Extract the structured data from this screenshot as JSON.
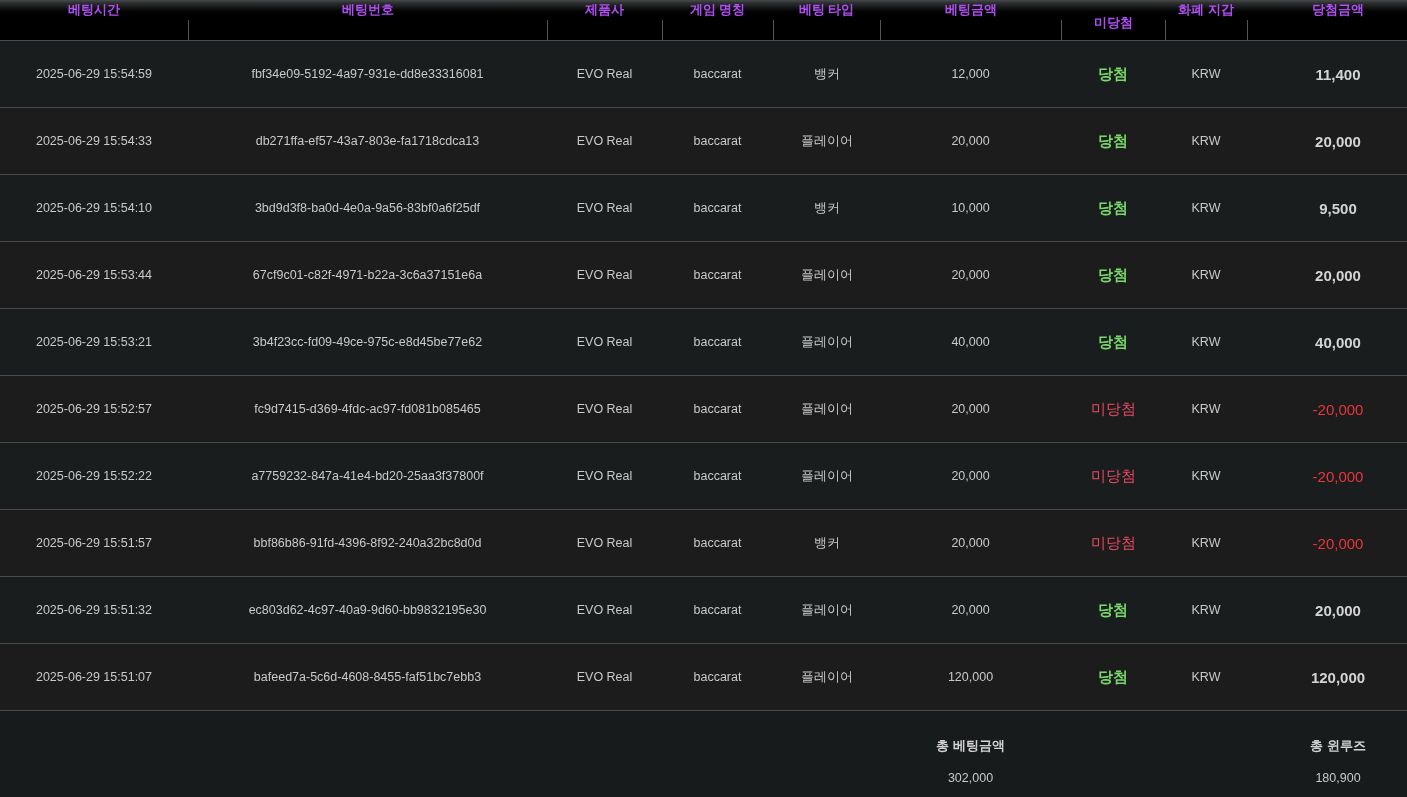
{
  "table": {
    "columns": [
      "베팅시간",
      "베팅번호",
      "제품사",
      "게임 명칭",
      "베팅 타입",
      "베팅금액",
      "미당첨",
      "화폐 지갑",
      "당첨금액"
    ],
    "rows": [
      {
        "time": "2025-06-29 15:54:59",
        "bet_id": "fbf34e09-5192-4a97-931e-dd8e33316081",
        "provider": "EVO Real",
        "game": "baccarat",
        "bet_type": "뱅커",
        "amount": "12,000",
        "result": "당첨",
        "won": true,
        "currency": "KRW",
        "payout": "11,400"
      },
      {
        "time": "2025-06-29 15:54:33",
        "bet_id": "db271ffa-ef57-43a7-803e-fa1718cdca13",
        "provider": "EVO Real",
        "game": "baccarat",
        "bet_type": "플레이어",
        "amount": "20,000",
        "result": "당첨",
        "won": true,
        "currency": "KRW",
        "payout": "20,000"
      },
      {
        "time": "2025-06-29 15:54:10",
        "bet_id": "3bd9d3f8-ba0d-4e0a-9a56-83bf0a6f25df",
        "provider": "EVO Real",
        "game": "baccarat",
        "bet_type": "뱅커",
        "amount": "10,000",
        "result": "당첨",
        "won": true,
        "currency": "KRW",
        "payout": "9,500"
      },
      {
        "time": "2025-06-29 15:53:44",
        "bet_id": "67cf9c01-c82f-4971-b22a-3c6a37151e6a",
        "provider": "EVO Real",
        "game": "baccarat",
        "bet_type": "플레이어",
        "amount": "20,000",
        "result": "당첨",
        "won": true,
        "currency": "KRW",
        "payout": "20,000"
      },
      {
        "time": "2025-06-29 15:53:21",
        "bet_id": "3b4f23cc-fd09-49ce-975c-e8d45be77e62",
        "provider": "EVO Real",
        "game": "baccarat",
        "bet_type": "플레이어",
        "amount": "40,000",
        "result": "당첨",
        "won": true,
        "currency": "KRW",
        "payout": "40,000"
      },
      {
        "time": "2025-06-29 15:52:57",
        "bet_id": "fc9d7415-d369-4fdc-ac97-fd081b085465",
        "provider": "EVO Real",
        "game": "baccarat",
        "bet_type": "플레이어",
        "amount": "20,000",
        "result": "미당첨",
        "won": false,
        "currency": "KRW",
        "payout": "-20,000"
      },
      {
        "time": "2025-06-29 15:52:22",
        "bet_id": "a7759232-847a-41e4-bd20-25aa3f37800f",
        "provider": "EVO Real",
        "game": "baccarat",
        "bet_type": "플레이어",
        "amount": "20,000",
        "result": "미당첨",
        "won": false,
        "currency": "KRW",
        "payout": "-20,000"
      },
      {
        "time": "2025-06-29 15:51:57",
        "bet_id": "bbf86b86-91fd-4396-8f92-240a32bc8d0d",
        "provider": "EVO Real",
        "game": "baccarat",
        "bet_type": "뱅커",
        "amount": "20,000",
        "result": "미당첨",
        "won": false,
        "currency": "KRW",
        "payout": "-20,000"
      },
      {
        "time": "2025-06-29 15:51:32",
        "bet_id": "ec803d62-4c97-40a9-9d60-bb9832195e30",
        "provider": "EVO Real",
        "game": "baccarat",
        "bet_type": "플레이어",
        "amount": "20,000",
        "result": "당첨",
        "won": true,
        "currency": "KRW",
        "payout": "20,000"
      },
      {
        "time": "2025-06-29 15:51:07",
        "bet_id": "bafeed7a-5c6d-4608-8455-faf51bc7ebb3",
        "provider": "EVO Real",
        "game": "baccarat",
        "bet_type": "플레이어",
        "amount": "120,000",
        "result": "당첨",
        "won": true,
        "currency": "KRW",
        "payout": "120,000"
      }
    ]
  },
  "totals": {
    "bet_label": "총 베팅금액",
    "bet_value": "302,000",
    "winlose_label": "총 윈루즈",
    "winlose_value": "180,900"
  }
}
